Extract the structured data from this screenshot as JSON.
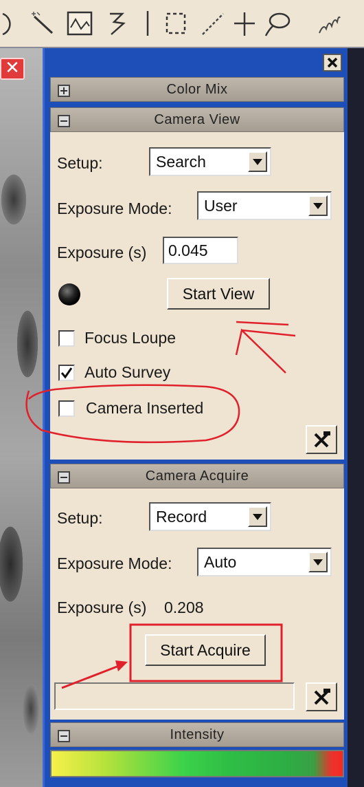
{
  "toolbar": {
    "icons": [
      "partial-circle-icon",
      "magic-wand-icon",
      "line-profile-icon",
      "arrow-tool-icon",
      "rectangle-select-icon",
      "line-tool-icon",
      "crosshair-icon",
      "lasso-icon",
      "freehand-icon"
    ]
  },
  "sections": {
    "color_mix": {
      "title": "Color Mix",
      "state": "collapsed"
    },
    "camera_view": {
      "title": "Camera View",
      "setup_label": "Setup:",
      "setup_value": "Search",
      "exposure_mode_label": "Exposure Mode:",
      "exposure_mode_value": "User",
      "exposure_label": "Exposure (s)",
      "exposure_value": "0.045",
      "start_view_label": "Start View",
      "focus_loupe_label": "Focus Loupe",
      "focus_loupe_checked": false,
      "auto_survey_label": "Auto Survey",
      "auto_survey_checked": true,
      "camera_inserted_label": "Camera Inserted",
      "camera_inserted_checked": false
    },
    "camera_acquire": {
      "title": "Camera Acquire",
      "setup_label": "Setup:",
      "setup_value": "Record",
      "exposure_mode_label": "Exposure Mode:",
      "exposure_mode_value": "Auto",
      "exposure_label": "Exposure (s)",
      "exposure_value": "0.208",
      "start_acquire_label": "Start Acquire"
    },
    "intensity": {
      "title": "Intensity"
    }
  },
  "colors": {
    "panel_bg": "#efe4d2",
    "frame_blue": "#1e4fb8",
    "annotation_red": "#e0202a"
  }
}
